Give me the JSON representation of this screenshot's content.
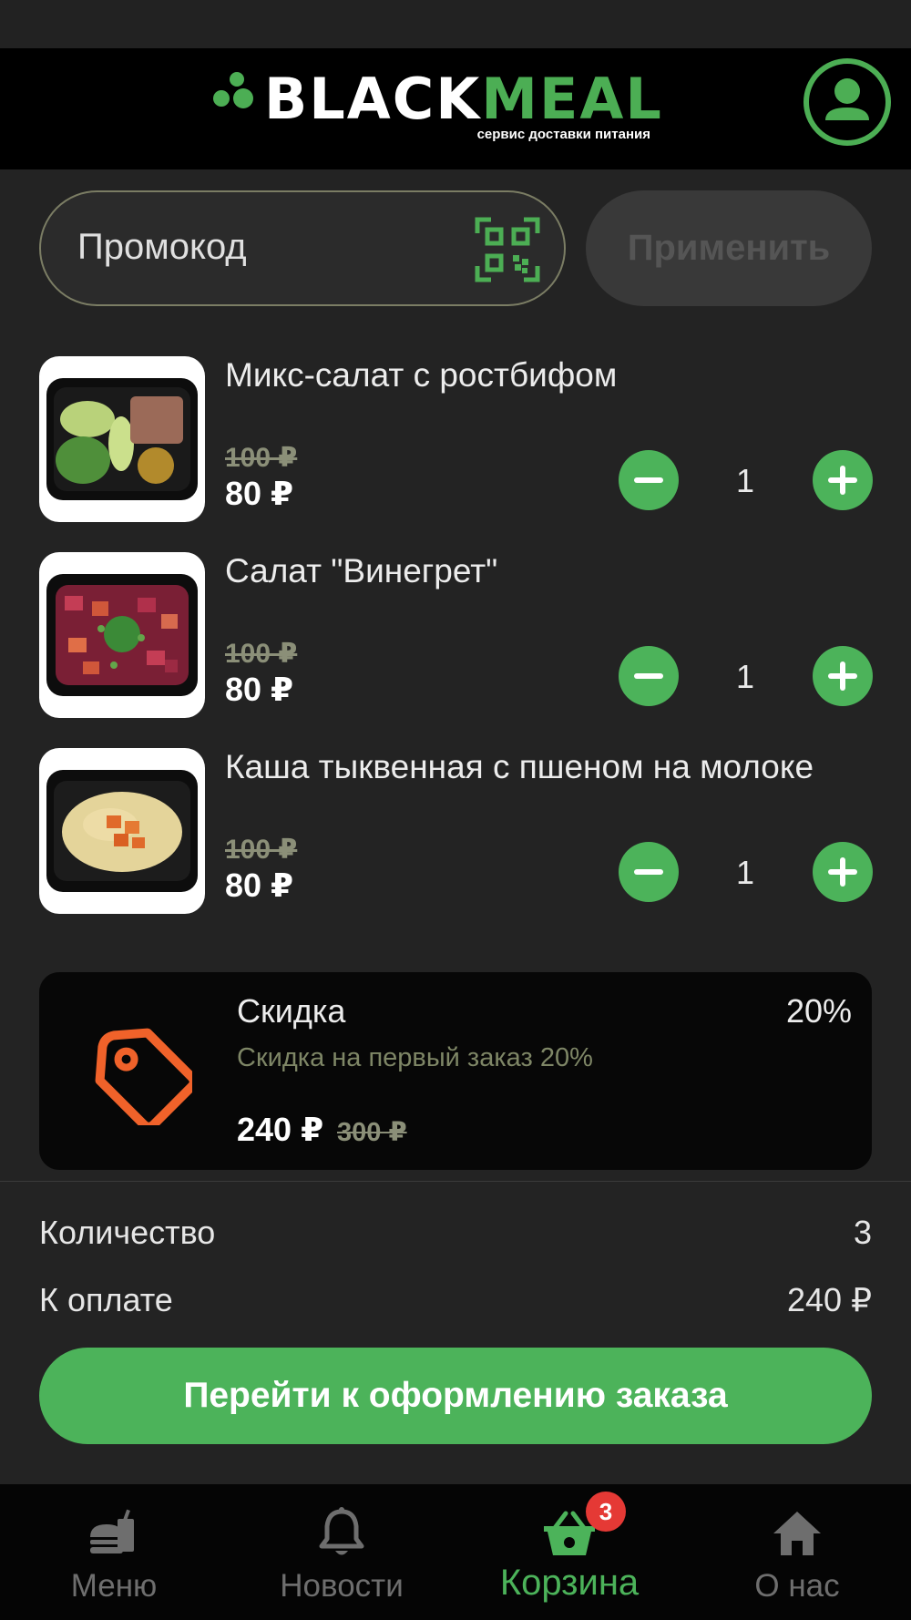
{
  "header": {
    "logo_word_white": "BLACK",
    "logo_word_green": "MEAL",
    "logo_subtitle": "сервис доставки питания",
    "profile_icon": "user-circle-icon"
  },
  "promo": {
    "placeholder": "Промокод",
    "value": "",
    "qr_icon": "qr-code-icon",
    "apply_label": "Применить"
  },
  "cart": {
    "items": [
      {
        "name": "Микс-салат с ростбифом",
        "old_price": "100 ₽",
        "price": "80 ₽",
        "quantity": "1"
      },
      {
        "name": "Салат \"Винегрет\"",
        "old_price": "100 ₽",
        "price": "80 ₽",
        "quantity": "1"
      },
      {
        "name": "Каша тыквенная с пшеном на молоке",
        "old_price": "100 ₽",
        "price": "80 ₽",
        "quantity": "1"
      }
    ]
  },
  "discount": {
    "title": "Скидка",
    "percent": "20%",
    "description": "Скидка на первый заказ 20%",
    "total": "240 ₽",
    "old_total": "300 ₽",
    "icon": "price-tag-icon"
  },
  "summary": {
    "quantity_label": "Количество",
    "quantity_value": "3",
    "pay_label": "К оплате",
    "pay_value": "240 ₽"
  },
  "checkout_label": "Перейти к оформлению заказа",
  "nav": {
    "items": [
      {
        "label": "Меню",
        "icon": "burger-drink-icon"
      },
      {
        "label": "Новости",
        "icon": "bell-icon"
      },
      {
        "label": "Корзина",
        "icon": "basket-icon",
        "badge": "3",
        "active": true
      },
      {
        "label": "О нас",
        "icon": "home-icon"
      }
    ]
  },
  "colors": {
    "accent": "#4cb35a",
    "background": "#232323",
    "badge": "#e53935",
    "tag_icon": "#f0622a"
  }
}
